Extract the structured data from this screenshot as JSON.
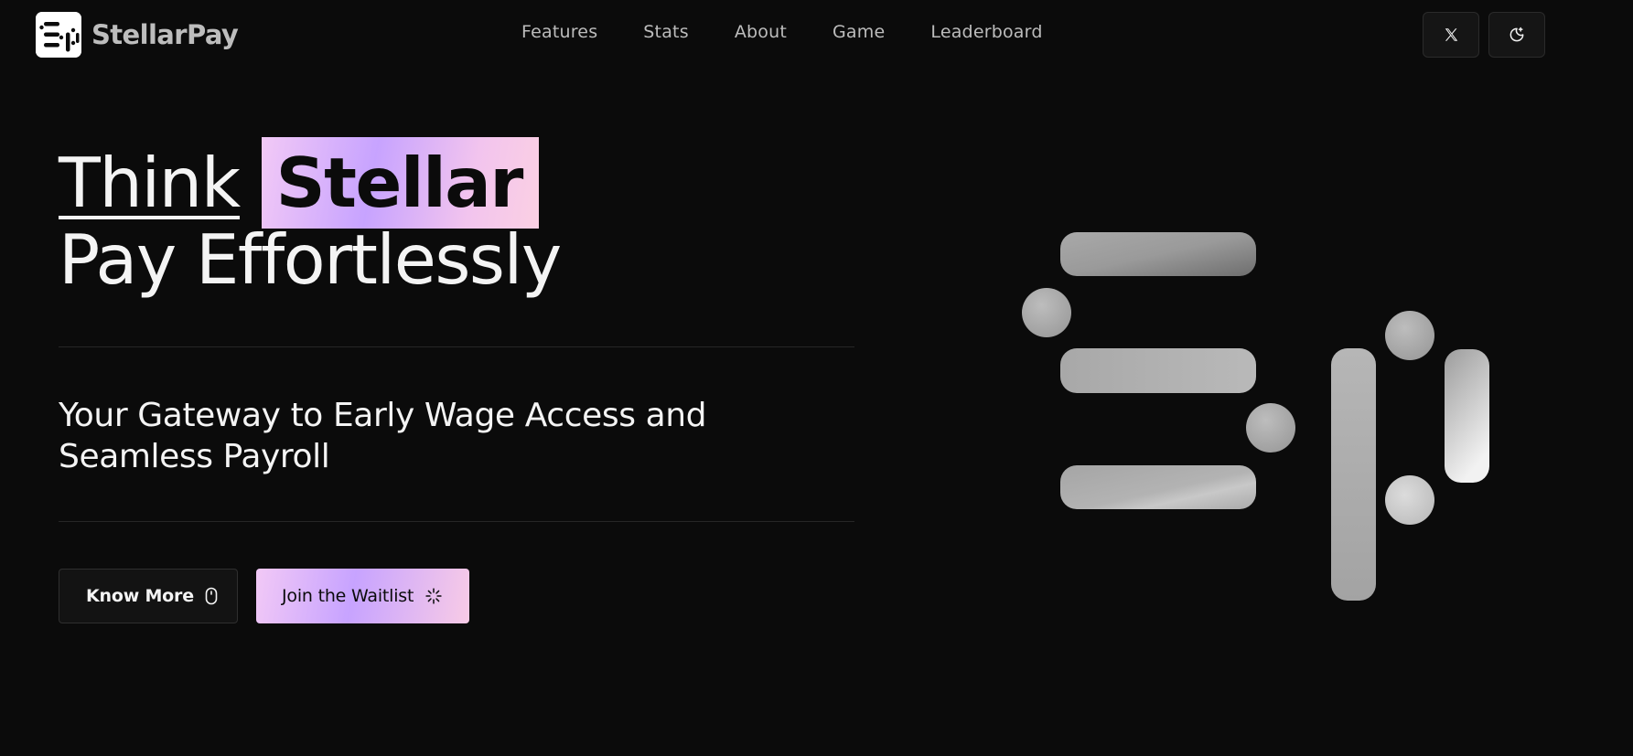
{
  "brand": {
    "name": "StellarPay",
    "logo_icon": "stellarpay-logo-icon"
  },
  "nav": {
    "items": [
      {
        "label": "Features"
      },
      {
        "label": "Stats"
      },
      {
        "label": "About"
      },
      {
        "label": "Game"
      },
      {
        "label": "Leaderboard"
      }
    ]
  },
  "header_buttons": {
    "x_icon": "x-logo-icon",
    "theme_icon": "moon-sparkle-icon"
  },
  "hero": {
    "headline_word1": "Think",
    "headline_highlight": "Stellar",
    "headline_line2": "Pay Effortlessly",
    "subheading": "Your Gateway to Early Wage Access and Seamless Payroll"
  },
  "cta": {
    "know_more": "Know More",
    "know_more_icon": "mouse-icon",
    "join_waitlist": "Join the Waitlist",
    "join_waitlist_icon": "loader-icon"
  },
  "colors": {
    "background": "#0b0b0b",
    "accent_gradient_start": "#f2c9f6",
    "accent_gradient_mid": "#c7a3ff",
    "accent_gradient_end": "#fbd0e3"
  }
}
